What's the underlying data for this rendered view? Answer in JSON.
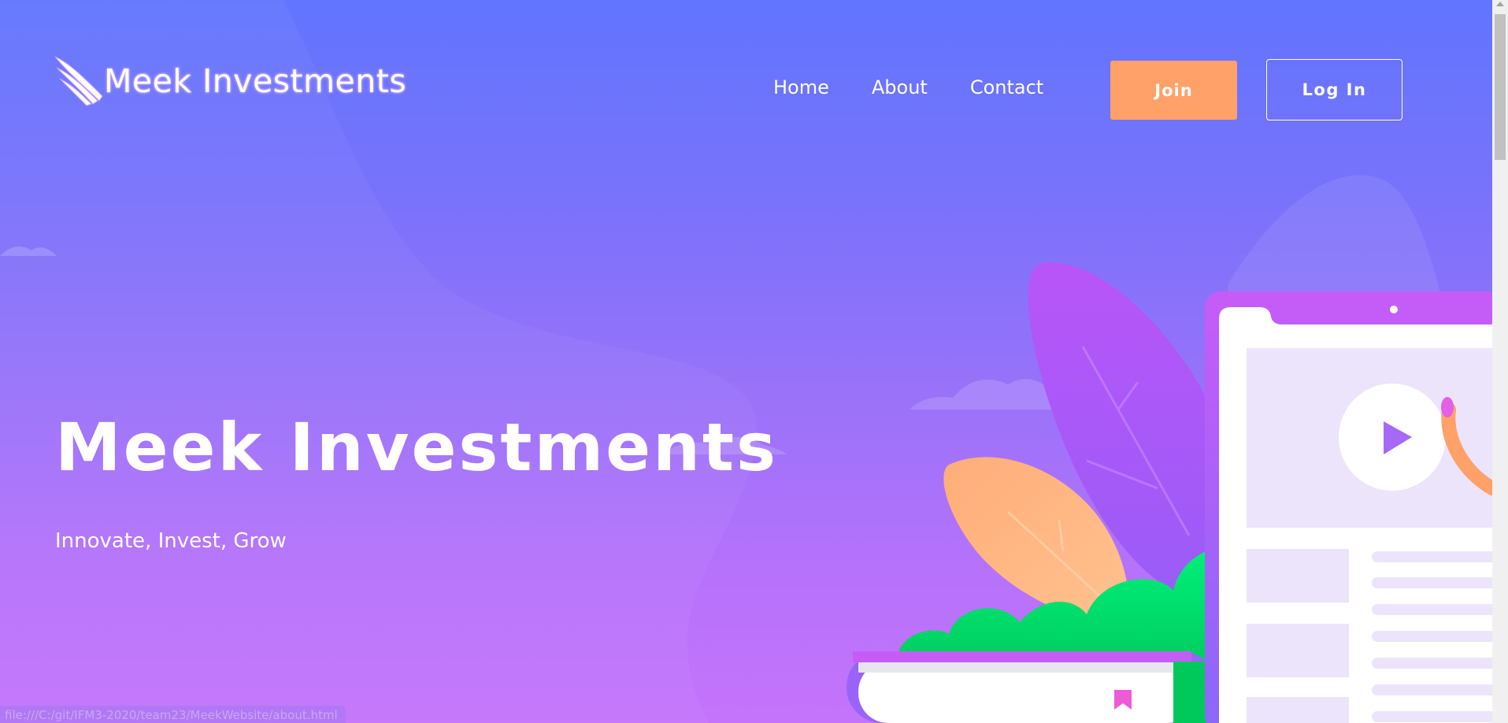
{
  "header": {
    "logo_text": "Meek Investments",
    "nav": [
      {
        "label": "Home"
      },
      {
        "label": "About"
      },
      {
        "label": "Contact"
      }
    ],
    "join_label": "Join",
    "login_label": "Log In"
  },
  "hero": {
    "title": "Meek Investments",
    "subtitle": "Innovate, Invest, Grow"
  },
  "status_bar": {
    "url": "file:///C:/git/IFM3-2020/team23/MeekWebsite/about.html"
  },
  "colors": {
    "gradient_top": "#6175fe",
    "gradient_bottom": "#c573fb",
    "join_button": "#ffa168",
    "bush_green": "#00e36f",
    "leaf_orange": "#ffb07a",
    "leaf_purple": "#b55af8"
  },
  "icons": [
    "wing-logo-icon",
    "play-icon",
    "bookmark-icon"
  ]
}
